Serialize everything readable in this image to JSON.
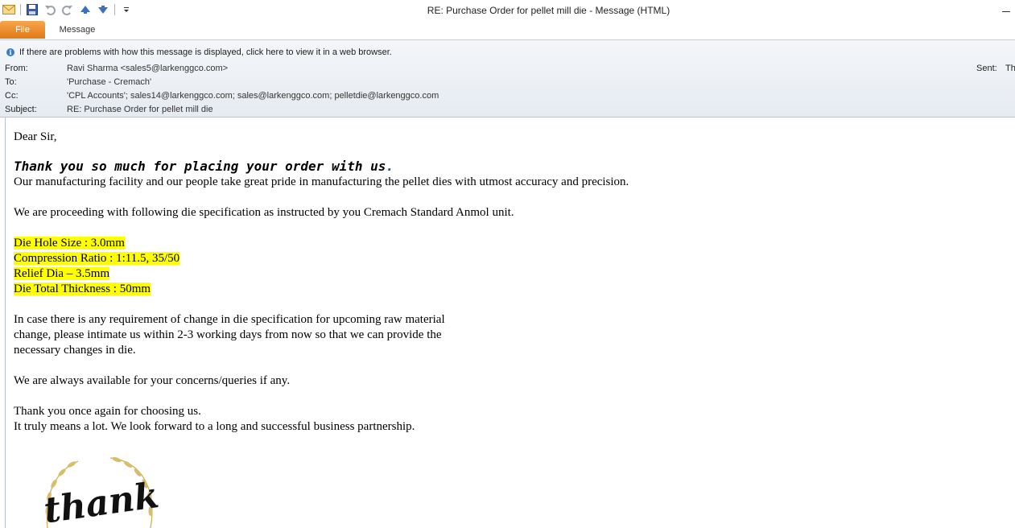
{
  "window": {
    "title": "RE: Purchase Order for pellet mill die  -  Message (HTML)"
  },
  "ribbon": {
    "tabs": [
      {
        "label": "File",
        "active": true
      },
      {
        "label": "Message",
        "active": false
      }
    ]
  },
  "quick_access": {
    "icons": [
      "mail-icon",
      "save-icon",
      "undo-icon",
      "redo-icon",
      "previous-item-icon",
      "next-item-icon",
      "customize-icon"
    ]
  },
  "info_bar": {
    "text": "If there are problems with how this message is displayed, click here to view it in a web browser."
  },
  "header": {
    "from_label": "From:",
    "from_value": "Ravi Sharma <sales5@larkenggco.com>",
    "to_label": "To:",
    "to_value": "'Purchase - Cremach'",
    "cc_label": "Cc:",
    "cc_value": "'CPL Accounts'; sales14@larkenggco.com; sales@larkenggco.com; pelletdie@larkenggco.com",
    "subject_label": "Subject:",
    "subject_value": "RE: Purchase Order for pellet mill die",
    "sent_label": "Sent:",
    "sent_value": "Th"
  },
  "message": {
    "greeting": "Dear Sir,",
    "thanks_heading": "Thank you so much for placing your order with us",
    "thanks_heading_end": ".",
    "para1": "Our manufacturing facility and our people take great pride in manufacturing the pellet dies with utmost accuracy and precision.",
    "para2": "We are proceeding with following die specification as instructed by you Cremach Standard Anmol unit.",
    "specs": [
      "Die Hole Size : 3.0mm",
      "Compression Ratio : 1:11.5, 35/50",
      "Relief Dia – 3.5mm",
      "Die Total Thickness : 50mm"
    ],
    "para3_lines": [
      "In case there is any requirement of change in die specification for upcoming raw material",
      "change, please intimate us within 2-3 working days from now so that we can provide the",
      "necessary changes in die."
    ],
    "para4": "We are always available for your concerns/queries if any.",
    "closing_lines": [
      "Thank you once again for choosing us.",
      "It truly means a lot. We look forward to a long and successful business partnership."
    ],
    "graphic_text": "thank you"
  },
  "colors": {
    "file_tab": "#e8861f",
    "highlight": "#ffff00",
    "header_bg": "#eaeef3"
  }
}
